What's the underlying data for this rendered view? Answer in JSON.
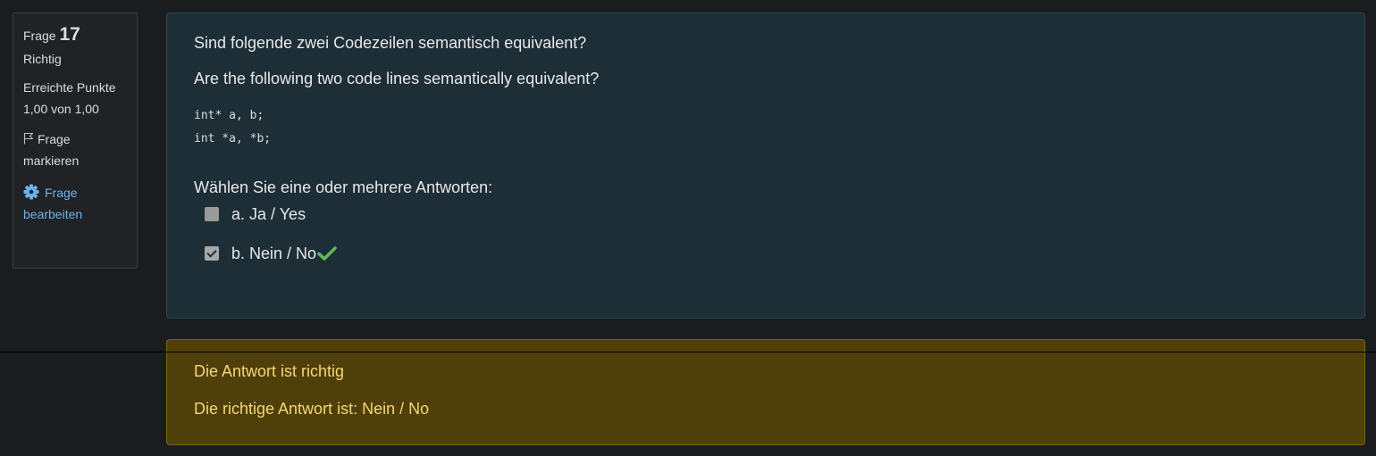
{
  "info": {
    "question_label": "Frage",
    "question_number": "17",
    "state": "Richtig",
    "grade": "Erreichte Punkte 1,00 von 1,00",
    "flag_label": "Frage markieren",
    "edit_label": "Frage bearbeiten"
  },
  "question": {
    "text_de": "Sind folgende zwei Codezeilen semantisch equivalent?",
    "text_en": "Are the following two code lines semantically equivalent?",
    "code_line_1": "int* a, b;",
    "code_line_2": "int *a, *b;",
    "prompt": "Wählen Sie eine oder mehrere Antworten:",
    "options": [
      {
        "label": "a. Ja / Yes",
        "checked": false
      },
      {
        "label": "b. Nein / No",
        "checked": true,
        "marked": "correct"
      }
    ]
  },
  "feedback": {
    "result": "Die Antwort ist richtig",
    "correct_answer": "Die richtige Antwort ist: Nein / No"
  },
  "colors": {
    "link": "#6ab4ec",
    "correct_tick": "#5cb85c",
    "feedback_text": "#f4d676",
    "feedback_bg": "#4f3f0a"
  },
  "icons": [
    "flag-icon",
    "gear-icon",
    "checkmark-icon"
  ]
}
